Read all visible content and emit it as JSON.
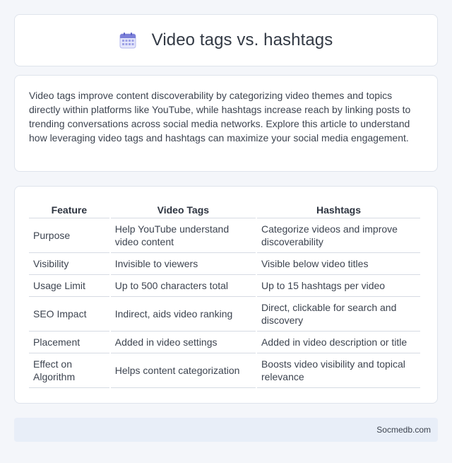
{
  "header": {
    "title": "Video tags vs. hashtags",
    "icon": "calendar-icon",
    "icon_color": "#7b7fd8"
  },
  "intro": {
    "text": "Video tags improve content discoverability by categorizing video themes and topics directly within platforms like YouTube, while hashtags increase reach by linking posts to trending conversations across social media networks. Explore this article to understand how leveraging video tags and hashtags can maximize your social media engagement."
  },
  "table": {
    "headers": [
      "Feature",
      "Video Tags",
      "Hashtags"
    ],
    "rows": [
      {
        "feature": "Purpose",
        "video_tags": "Help YouTube understand video content",
        "hashtags": "Categorize videos and improve discoverability"
      },
      {
        "feature": "Visibility",
        "video_tags": "Invisible to viewers",
        "hashtags": "Visible below video titles"
      },
      {
        "feature": "Usage Limit",
        "video_tags": "Up to 500 characters total",
        "hashtags": "Up to 15 hashtags per video"
      },
      {
        "feature": "SEO Impact",
        "video_tags": "Indirect, aids video ranking",
        "hashtags": "Direct, clickable for search and discovery"
      },
      {
        "feature": "Placement",
        "video_tags": "Added in video settings",
        "hashtags": "Added in video description or title"
      },
      {
        "feature": "Effect on Algorithm",
        "video_tags": "Helps content categorization",
        "hashtags": "Boosts video visibility and topical relevance"
      }
    ]
  },
  "footer": {
    "site": "Socmedb.com"
  }
}
